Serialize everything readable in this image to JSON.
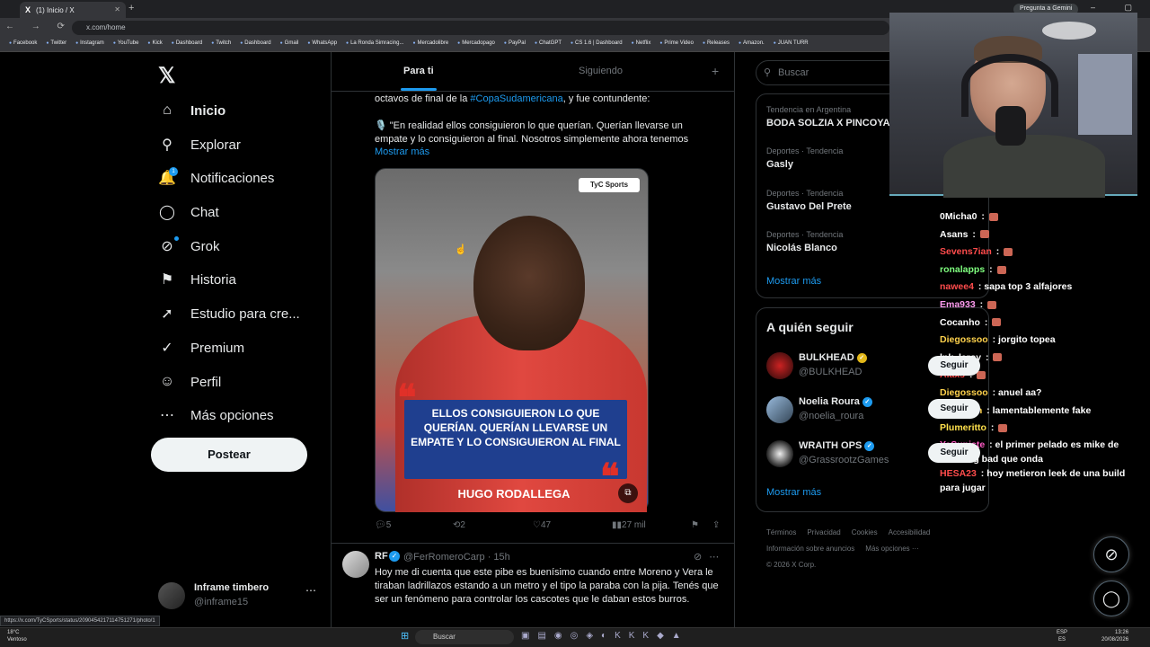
{
  "browser": {
    "tab_title": "(1) Inicio / X",
    "tab_favicon": "X",
    "new_tab": "+",
    "gemini_button": "Pregunta a Gemini",
    "window_controls": "– ▢ ✕",
    "nav_buttons": "← → ⟳ ⌂",
    "url": "x.com/home",
    "bookmarks": [
      "Facebook",
      "Twitter",
      "Instagram",
      "YouTube",
      "Kick",
      "Dashboard",
      "Twitch",
      "Dashboard",
      "Gmail",
      "WhatsApp",
      "La Ronda Simracing...",
      "Mercadolibre",
      "Mercadopago",
      "PayPal",
      "ChatGPT",
      "CS 1.6 | Dashboard",
      "Netflix",
      "Prime Video",
      "Releases",
      "Amazon.",
      "JUAN TURR"
    ],
    "status_link": "https://x.com/TyCSports/status/2090454217114751271/photo/1"
  },
  "sidebar": {
    "logo": "𝕏",
    "items": [
      {
        "label": "Inicio",
        "icon": "home-icon",
        "glyph": "⌂"
      },
      {
        "label": "Explorar",
        "icon": "search-icon",
        "glyph": "⚲"
      },
      {
        "label": "Notificaciones",
        "icon": "bell-icon",
        "glyph": "🔔"
      },
      {
        "label": "Chat",
        "icon": "chat-icon",
        "glyph": "◯"
      },
      {
        "label": "Grok",
        "icon": "grok-icon",
        "glyph": "⊘"
      },
      {
        "label": "Historia",
        "icon": "bookmark-icon",
        "glyph": "⚑"
      },
      {
        "label": "Estudio para cre...",
        "icon": "rocket-icon",
        "glyph": "➚"
      },
      {
        "label": "Premium",
        "icon": "verified-icon",
        "glyph": "✓"
      },
      {
        "label": "Perfil",
        "icon": "person-icon",
        "glyph": "☺"
      },
      {
        "label": "Más opciones",
        "icon": "more-circle-icon",
        "glyph": "⋯"
      }
    ],
    "notif_count": "1",
    "post_button": "Postear",
    "profile": {
      "name": "Inframe timbero",
      "handle": "@inframe15",
      "more": "⋯"
    }
  },
  "feed": {
    "tabs": {
      "for_you": "Para ti",
      "following": "Siguiendo",
      "plus": "+"
    },
    "tweet1": {
      "line1_pre": "octavos de final de la ",
      "line1_link": "#CopaSudamericana",
      "line1_post": ", y fue contundente:",
      "body": "🎙️ \"En realidad ellos consiguieron lo que querían. Querían llevarse un empate y lo consiguieron al final. Nosotros simplemente ahora tenemos",
      "show_more": "Mostrar más",
      "media": {
        "brand": "TyC Sports",
        "quote": "ELLOS CONSIGUIERON LO QUE QUERÍAN. QUERÍAN LLEVARSE UN EMPATE Y LO CONSIGUIERON AL FINAL",
        "name": "HUGO RODALLEGA",
        "quote_mark": "❝"
      },
      "replies": "5",
      "retweets": "2",
      "likes": "47",
      "views": "27 mil"
    },
    "tweet2": {
      "name": "RF",
      "handle": "@FerRomeroCarp · 15h",
      "text": "Hoy me di cuenta que este pibe es buenísimo cuando entre Moreno y Vera le tiraban ladrillazos estando a un metro y el tipo la paraba con la pija. Tenés que ser un fenómeno para controlar los cascotes que le daban estos burros."
    }
  },
  "right": {
    "search_placeholder": "Buscar",
    "trends": [
      {
        "cat": "Tendencia en Argentina",
        "title": "BODA SOLZIA X PINCOYA"
      },
      {
        "cat": "Deportes · Tendencia",
        "title": "Gasly"
      },
      {
        "cat": "Deportes · Tendencia",
        "title": "Gustavo Del Prete"
      },
      {
        "cat": "Deportes · Tendencia",
        "title": "Nicolás Blanco"
      }
    ],
    "trends_more": "Mostrar más",
    "follow_title": "A quién seguir",
    "follow": [
      {
        "name": "BULKHEAD",
        "handle": "@BULKHEAD",
        "badge_color": "#e2b719"
      },
      {
        "name": "Noelia Roura",
        "handle": "@noelia_roura",
        "badge_color": "#1d9bf0"
      },
      {
        "name": "WRAITH OPS",
        "handle": "@GrassrootzGames",
        "badge_color": "#1d9bf0"
      }
    ],
    "follow_button": "Seguir",
    "follow_more": "Mostrar más",
    "footer": [
      "Términos",
      "Privacidad",
      "Cookies",
      "Accesibilidad",
      "Información sobre anuncios",
      "Más opciones ···",
      "© 2026 X Corp."
    ]
  },
  "chat": [
    {
      "user": "0Micha0",
      "color": "#ffffff",
      "msg": ""
    },
    {
      "user": "Asans",
      "color": "#ffffff",
      "msg": ""
    },
    {
      "user": "Sevens7ian",
      "color": "#ff4c4c",
      "msg": ""
    },
    {
      "user": "ronalapps",
      "color": "#7fff7f",
      "msg": ""
    },
    {
      "user": "nawee4",
      "color": "#ff4c4c",
      "msg": "sapa top 3 alfajores"
    },
    {
      "user": "Ema933",
      "color": "#ff9cf0",
      "msg": ""
    },
    {
      "user": "Cocanho",
      "color": "#ffffff",
      "msg": ""
    },
    {
      "user": "Diegossoo",
      "color": "#ffd24c",
      "msg": "jorgito topea"
    },
    {
      "user": "lnk_leroy",
      "color": "#ffffff",
      "msg": ""
    },
    {
      "user": "Alaxs",
      "color": "#ff4c4c",
      "msg": ""
    },
    {
      "user": "Diegossoo",
      "color": "#ffd24c",
      "msg": "anuel aa?"
    },
    {
      "user": "gentrown",
      "color": "#ffd24c",
      "msg": "lamentablemente fake"
    },
    {
      "user": "Plumeritto",
      "color": "#ffe14c",
      "msg": ""
    },
    {
      "user": "YaSupiste",
      "color": "#ff5cc6",
      "msg": "el primer pelado es mike de breaking bad que onda"
    },
    {
      "user": "HESA23",
      "color": "#ff4c4c",
      "msg": "hoy metieron leek de una build para jugar"
    }
  ],
  "taskbar": {
    "weather_temp": "18°C",
    "weather_desc": "Ventoso",
    "search": "Buscar",
    "lang": "ESP",
    "lang2": "ES",
    "time": "13:26",
    "date": "20/08/2026"
  }
}
